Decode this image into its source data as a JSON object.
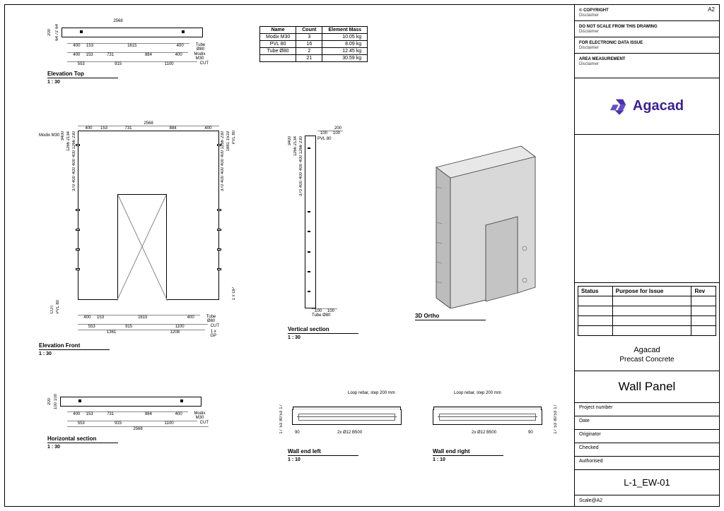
{
  "sheet_size": "A2",
  "titleblock": {
    "copyright": {
      "title": "© COPYRIGHT",
      "text": "Disclaimer"
    },
    "scale_warn": {
      "title": "DO NOT SCALE FROM THIS DRAWING",
      "text": "Disclaimer"
    },
    "electronic": {
      "title": "FOR ELECTRONIC DATA ISSUE",
      "text": "Disclaimer"
    },
    "area": {
      "title": "AREA MEASUREMENT",
      "text": "Disclaimer"
    },
    "logo_text": "Agacad",
    "rev_headers": [
      "Status",
      "Purpose for Issue",
      "Rev"
    ],
    "company": "Agacad",
    "project": "Precast Concrete",
    "drawing_title": "Wall Panel",
    "fields": {
      "project_number": "Project number",
      "date": "Date",
      "originator": "Originator",
      "checked": "Checked",
      "authorised": "Authorised"
    },
    "drawing_number": "L-1_EW-01",
    "scale": "Scale@A2"
  },
  "bom": {
    "headers": [
      "Name",
      "Count",
      "Element Mass"
    ],
    "rows": [
      [
        "Modix M30",
        "3",
        "10.05 kg"
      ],
      [
        "PVL 80",
        "16",
        "8.09 kg"
      ],
      [
        "Tube Ø80",
        "2",
        "12.45 kg"
      ],
      [
        "",
        "21",
        "30.59 kg"
      ]
    ]
  },
  "views": {
    "elev_top": {
      "title": "Elevation Top",
      "scale": "1 : 30"
    },
    "elev_front": {
      "title": "Elevation Front",
      "scale": "1 : 30"
    },
    "horiz": {
      "title": "Horizontal section",
      "scale": "1 : 30"
    },
    "vert": {
      "title": "Vertical section",
      "scale": "1 : 30"
    },
    "iso": {
      "title": "3D Ortho",
      "scale": ""
    },
    "wall_left": {
      "title": "Wall end left",
      "scale": "1 : 10"
    },
    "wall_right": {
      "title": "Wall end right",
      "scale": "1 : 10"
    }
  },
  "dims": {
    "overall_w": "2568",
    "overall_h": "3400",
    "top_200": "200",
    "top_64_72_64": [
      "64",
      "72",
      "64"
    ],
    "row1": [
      "400",
      "153",
      "1615",
      "400"
    ],
    "row1_lbl": "Tube Ø80",
    "row2": [
      "400",
      "153",
      "731",
      "884",
      "400"
    ],
    "row2_lbl": "Modix M30",
    "row3": [
      "553",
      "915",
      "1100"
    ],
    "row3_lbl": "CUT",
    "front_bottom_a": [
      "400",
      "153",
      "1615",
      "400"
    ],
    "front_bottom_b": [
      "553",
      "915",
      "1100"
    ],
    "front_bottom_c": [
      "1361",
      "1208"
    ],
    "front_bottom_c_lbl": "1 x GP",
    "side_v": [
      "230",
      "1266",
      "400",
      "400",
      "400",
      "400",
      "370"
    ],
    "side_v_total": "2134",
    "side_r": [
      "1519",
      "1881"
    ],
    "pvl_lbl": "PVL 80",
    "gp_lbl": "1 x GP",
    "vert_top": [
      "200",
      "100",
      "100"
    ],
    "vert_bot": [
      "100",
      "100"
    ],
    "tube_lbl": "Tube Ø80",
    "wall_end_annot1": "Loop rebar,\nstep 200 mm",
    "wall_end_annot2": "2x Ø12 B500",
    "wall_end_dims_h": "90",
    "wall_end_dims_v": [
      "17",
      "53",
      "80",
      "53",
      "17"
    ],
    "horiz_left": [
      "200",
      "100",
      "100"
    ]
  }
}
